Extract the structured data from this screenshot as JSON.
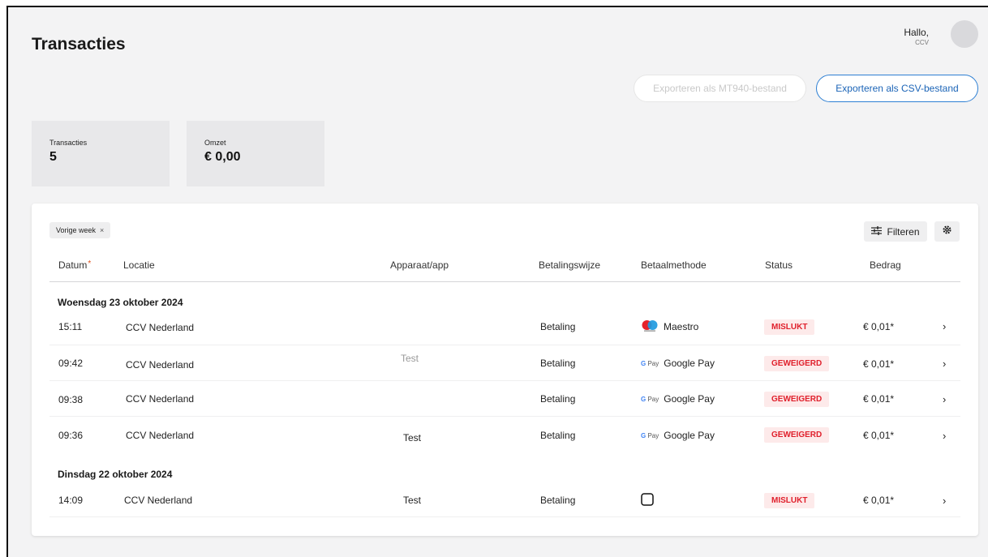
{
  "page": {
    "title": "Transacties"
  },
  "header": {
    "greeting": "Hallo,",
    "user": "CCV"
  },
  "actions": {
    "export_mt940": "Exporteren als MT940-bestand",
    "export_csv": "Exporteren als CSV-bestand"
  },
  "stats": [
    {
      "label": "Transacties",
      "value": "5"
    },
    {
      "label": "Omzet",
      "value": "€ 0,00"
    }
  ],
  "filters": {
    "active_chip": "Vorige week",
    "chip_remove": "×",
    "filter_button": "Filteren"
  },
  "table": {
    "columns": [
      "Datum",
      "Locatie",
      "Apparaat/app",
      "Betalingswijze",
      "Betaalmethode",
      "Status",
      "Bedrag"
    ],
    "groups": [
      {
        "date": "Woensdag 23 oktober 2024",
        "rows": [
          {
            "time": "15:11",
            "location": "CCV Nederland",
            "device": "",
            "type": "Betaling",
            "method": "Maestro",
            "status": "MISLUKT",
            "amount": "€ 0,01*"
          },
          {
            "time": "09:42",
            "location": "CCV Nederland",
            "device": "Test",
            "type": "Betaling",
            "method": "Google Pay",
            "status": "GEWEIGERD",
            "amount": "€ 0,01*"
          },
          {
            "time": "09:38",
            "location": "CCV Nederland",
            "device": "",
            "type": "Betaling",
            "method": "Google Pay",
            "status": "GEWEIGERD",
            "amount": "€ 0,01*"
          },
          {
            "time": "09:36",
            "location": "CCV Nederland",
            "device": "Test",
            "type": "Betaling",
            "method": "Google Pay",
            "status": "GEWEIGERD",
            "amount": "€ 0,01*"
          }
        ]
      },
      {
        "date": "Dinsdag 22 oktober 2024",
        "rows": [
          {
            "time": "14:09",
            "location": "CCV Nederland",
            "device": "Test",
            "type": "Betaling",
            "method": "",
            "status": "MISLUKT",
            "amount": "€ 0,01*"
          }
        ]
      }
    ]
  },
  "icons": {
    "filter": "sliders-icon",
    "settings": "gear-icon",
    "row_open": "chevron-right-icon",
    "maestro": "maestro-logo-icon",
    "google_pay": "google-pay-icon",
    "card_unknown": "card-outline-icon"
  },
  "colors": {
    "accent": "#1b64b7",
    "status_error_bg": "#fdeaea",
    "status_error_text": "#e0202c",
    "required_marker": "#e0501b"
  }
}
